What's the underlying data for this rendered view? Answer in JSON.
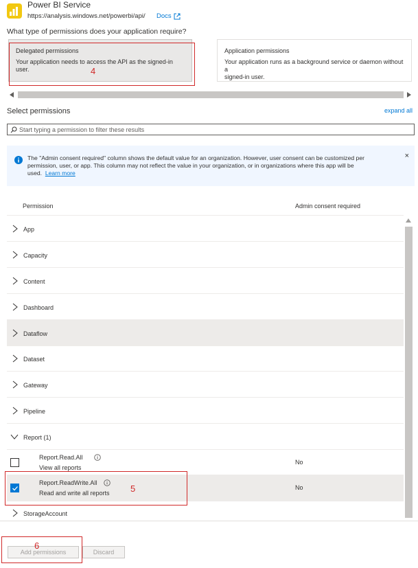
{
  "header": {
    "api_name": "Power BI Service",
    "api_url": "https://analysis.windows.net/powerbi/api/",
    "docs_label": "Docs"
  },
  "question": "What type of permissions does your application require?",
  "permission_types": {
    "delegated": {
      "title": "Delegated permissions",
      "description": "Your application needs to access the API as the signed-in user."
    },
    "application": {
      "title": "Application permissions",
      "description_line1": "Your application runs as a background service or daemon without a",
      "description_line2": "signed-in user."
    }
  },
  "select_permissions_label": "Select permissions",
  "expand_all_label": "expand all",
  "filter": {
    "placeholder": "Start typing a permission to filter these results",
    "value": ""
  },
  "info_bar": {
    "line1": "The \"Admin consent required\" column shows the default value for an organization. However, user consent can be customized per",
    "line2": "permission, user, or app. This column may not reflect the value in your organization, or in organizations where this app will be",
    "line3": "used.",
    "learn_more": "Learn more",
    "close_label": "×"
  },
  "table": {
    "col_permission": "Permission",
    "col_admin": "Admin consent required",
    "groups": [
      {
        "name": "App"
      },
      {
        "name": "Capacity"
      },
      {
        "name": "Content"
      },
      {
        "name": "Dashboard"
      },
      {
        "name": "Dataflow"
      },
      {
        "name": "Dataset"
      },
      {
        "name": "Gateway"
      },
      {
        "name": "Pipeline"
      },
      {
        "name": "Report (1)"
      },
      {
        "name": "StorageAccount"
      }
    ],
    "report_permissions": [
      {
        "name": "Report.Read.All",
        "description": "View all reports",
        "admin": "No",
        "checked": false
      },
      {
        "name": "Report.ReadWrite.All",
        "description": "Read and write all reports",
        "admin": "No",
        "checked": true
      }
    ]
  },
  "buttons": {
    "add": "Add permissions",
    "discard": "Discard"
  },
  "annotations": {
    "a4": "4",
    "a5": "5",
    "a6": "6"
  },
  "colors": {
    "accent": "#0078d4",
    "annotation": "#d02828",
    "info_bg": "#f0f6ff"
  }
}
